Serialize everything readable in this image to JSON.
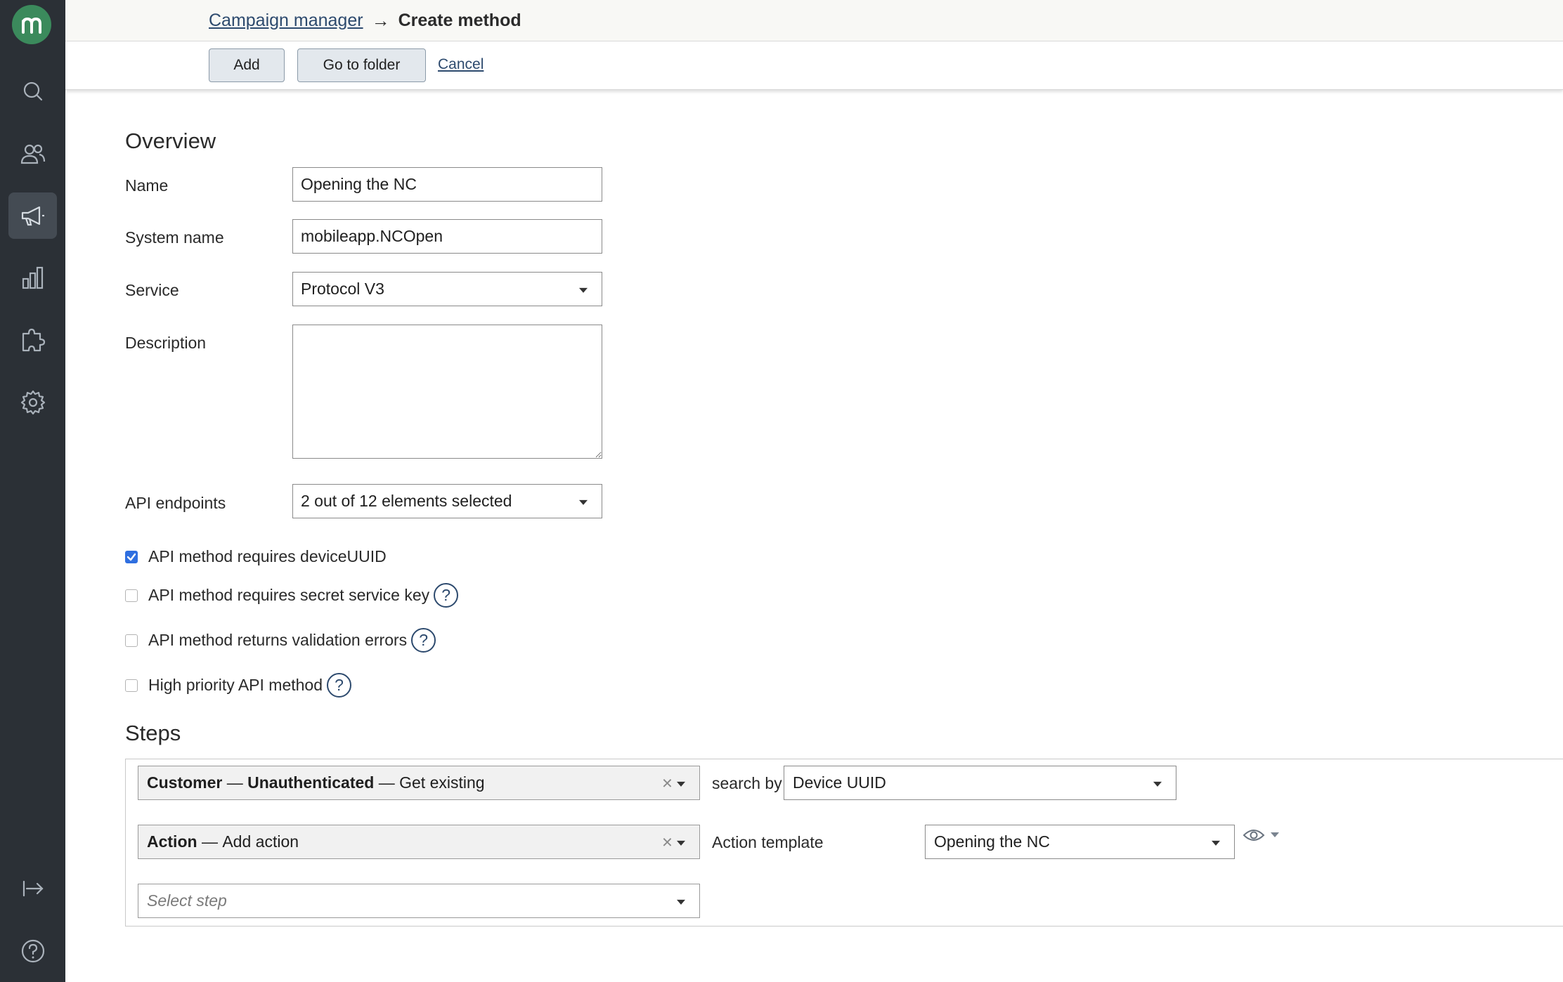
{
  "app": {
    "logo_letter": "m"
  },
  "sidebar": {
    "items": [
      {
        "name": "search",
        "icon": "search-icon"
      },
      {
        "name": "customers",
        "icon": "users-icon"
      },
      {
        "name": "campaigns",
        "icon": "megaphone-icon",
        "active": true
      },
      {
        "name": "analytics",
        "icon": "bar-chart-icon"
      },
      {
        "name": "integrations",
        "icon": "puzzle-icon"
      },
      {
        "name": "settings",
        "icon": "gear-icon"
      },
      {
        "name": "logout",
        "icon": "logout-icon"
      },
      {
        "name": "help",
        "icon": "help-icon"
      }
    ]
  },
  "header": {
    "breadcrumb_link": "Campaign manager",
    "breadcrumb_arrow": "→",
    "title": "Create method"
  },
  "toolbar": {
    "add_label": "Add",
    "folder_label": "Go to folder",
    "cancel_label": "Cancel"
  },
  "overview": {
    "title": "Overview",
    "name_label": "Name",
    "name_value": "Opening the NC",
    "system_name_label": "System name",
    "system_name_value": "mobileapp.NCOpen",
    "service_label": "Service",
    "service_value": "Protocol V3",
    "description_label": "Description",
    "description_value": "",
    "api_endpoints_label": "API endpoints",
    "api_endpoints_value": "2 out of 12 elements selected"
  },
  "options": [
    {
      "label": "API method requires deviceUUID",
      "checked": true,
      "help": false
    },
    {
      "label": "API method requires secret service key",
      "checked": false,
      "help": true
    },
    {
      "label": "API method returns validation errors",
      "checked": false,
      "help": true
    },
    {
      "label": "High priority API method",
      "checked": false,
      "help": true
    }
  ],
  "help_glyph": "?",
  "steps": {
    "title": "Steps",
    "step1": {
      "part1": "Customer",
      "sep1": " — ",
      "part2": "Unauthenticated",
      "sep2": " — ",
      "part3": "Get existing"
    },
    "search_by_label": "search by",
    "search_by_value": "Device UUID",
    "step2": {
      "part1": "Action",
      "sep1": " — ",
      "part2": "Add action"
    },
    "action_template_label": "Action template",
    "action_template_value": "Opening the NC",
    "select_step_placeholder": "Select step",
    "clear_glyph": "×"
  },
  "colors": {
    "sidebar_bg": "#2b3036",
    "logo_bg": "#3b8a5c",
    "link": "#2d4a6e",
    "checkbox_checked": "#2f6fe0"
  }
}
